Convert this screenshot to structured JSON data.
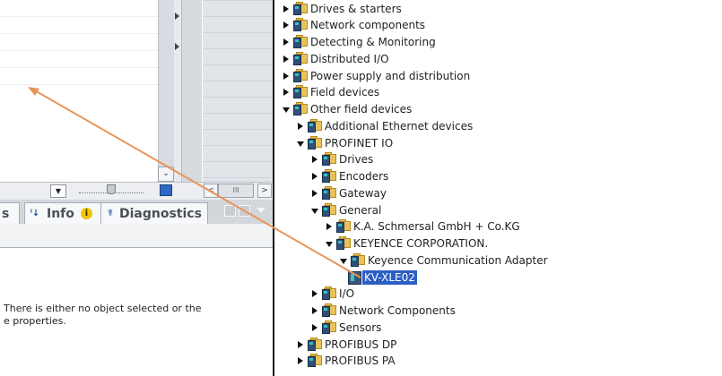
{
  "tabs": {
    "properties_fragment": "s",
    "info": "Info",
    "diagnostics": "Diagnostics"
  },
  "properties_message": {
    "line1": "There is either no object selected or the",
    "line2": "e properties."
  },
  "hscroll_label": "III",
  "tree": [
    {
      "label": "Drives & starters",
      "level": 0,
      "state": "closed",
      "icon": "folder-device-icon"
    },
    {
      "label": "Network components",
      "level": 0,
      "state": "closed",
      "icon": "folder-device-icon"
    },
    {
      "label": "Detecting & Monitoring",
      "level": 0,
      "state": "closed",
      "icon": "folder-device-icon"
    },
    {
      "label": "Distributed I/O",
      "level": 0,
      "state": "closed",
      "icon": "folder-device-icon"
    },
    {
      "label": "Power supply and distribution",
      "level": 0,
      "state": "closed",
      "icon": "folder-device-icon"
    },
    {
      "label": "Field devices",
      "level": 0,
      "state": "closed",
      "icon": "folder-device-icon"
    },
    {
      "label": "Other field devices",
      "level": 0,
      "state": "open",
      "icon": "folder-device-icon"
    },
    {
      "label": "Additional Ethernet devices",
      "level": 1,
      "state": "closed",
      "icon": "folder-device-icon"
    },
    {
      "label": "PROFINET IO",
      "level": 1,
      "state": "open",
      "icon": "folder-device-icon"
    },
    {
      "label": "Drives",
      "level": 2,
      "state": "closed",
      "icon": "folder-device-icon"
    },
    {
      "label": "Encoders",
      "level": 2,
      "state": "closed",
      "icon": "folder-device-icon"
    },
    {
      "label": "Gateway",
      "level": 2,
      "state": "closed",
      "icon": "folder-device-icon"
    },
    {
      "label": "General",
      "level": 2,
      "state": "open",
      "icon": "folder-device-icon"
    },
    {
      "label": "K.A. Schmersal GmbH + Co.KG",
      "level": 3,
      "state": "closed",
      "icon": "folder-device-icon"
    },
    {
      "label": "KEYENCE CORPORATION.",
      "level": 3,
      "state": "open",
      "icon": "folder-device-icon"
    },
    {
      "label": "Keyence Communication Adapter",
      "level": 4,
      "state": "open",
      "icon": "folder-device-icon"
    },
    {
      "label": "KV-XLE02",
      "level": 5,
      "state": "leaf",
      "icon": "device-icon",
      "selected": true
    },
    {
      "label": "I/O",
      "level": 2,
      "state": "closed",
      "icon": "folder-device-icon"
    },
    {
      "label": "Network Components",
      "level": 2,
      "state": "closed",
      "icon": "folder-device-icon"
    },
    {
      "label": "Sensors",
      "level": 2,
      "state": "closed",
      "icon": "folder-device-icon"
    },
    {
      "label": "PROFIBUS DP",
      "level": 1,
      "state": "closed",
      "icon": "folder-device-icon"
    },
    {
      "label": "PROFIBUS PA",
      "level": 1,
      "state": "closed",
      "icon": "folder-device-icon"
    }
  ],
  "colors": {
    "selection": "#2c5fc4",
    "drag_arrow": "#e8955a",
    "folder": "#e9c35a"
  }
}
